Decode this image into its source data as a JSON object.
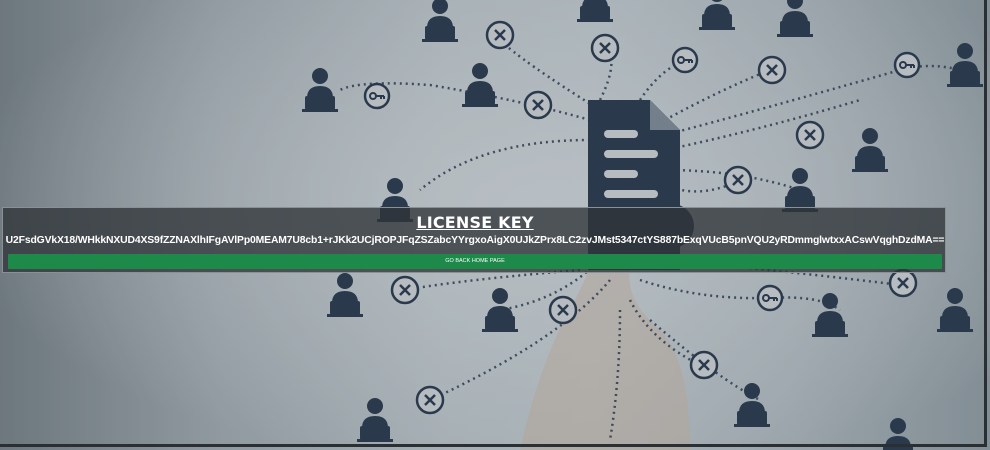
{
  "panel": {
    "title": "LICENSE KEY",
    "key": "U2FsdGVkX18/WHkkNXUD4XS9fZZNAXlhIFgAVlPp0MEAM7U8cb1+rJKk2UCjROPJFqZSZabcYYrgxoAigX0UJkZPrx8LC2zvJMst5347ctYS887bExqVUcB5pnVQU2yRDmmglwtxxACswVqghDzdMA==",
    "button_label": "GO BACK HOME PAGE"
  },
  "colors": {
    "button": "#1e8a4a",
    "icons": "#2f3f55",
    "panel": "#303438"
  },
  "background": {
    "icons": [
      "person-at-laptop-icon",
      "key-icon",
      "x-circle-icon",
      "document-icon",
      "lock-icon"
    ]
  }
}
